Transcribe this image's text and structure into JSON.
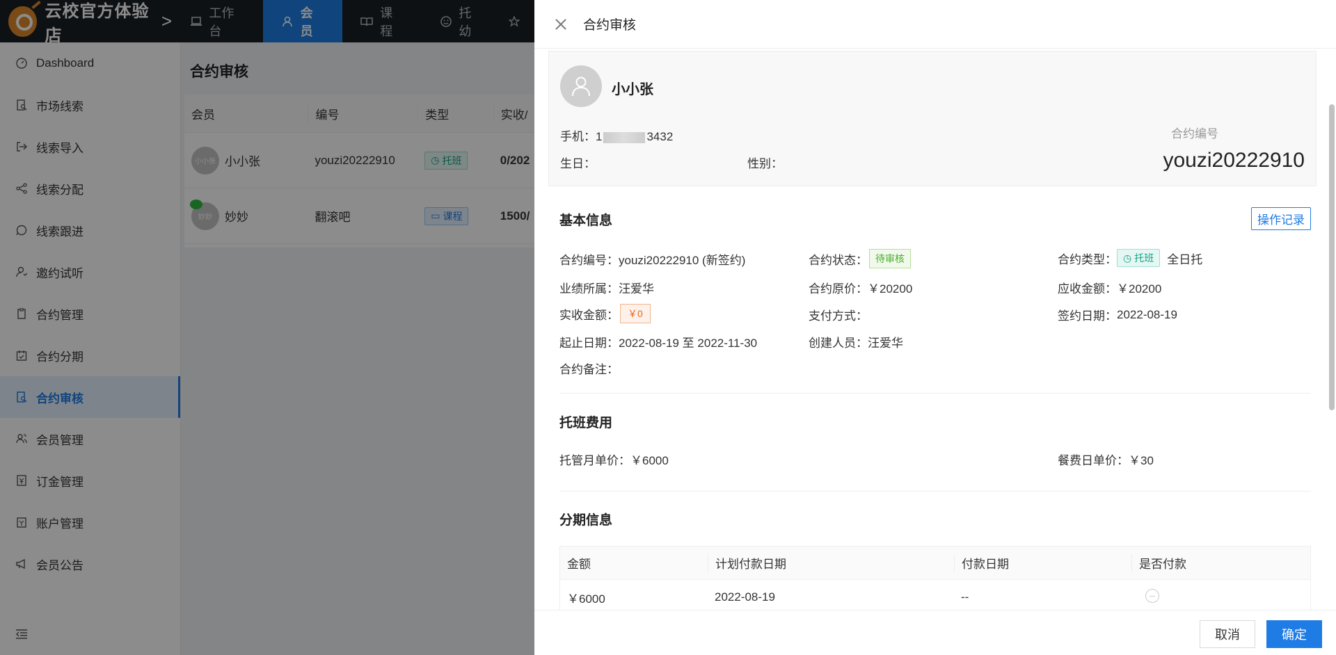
{
  "app": {
    "brand": "云校官方体验店",
    "brand_arrow": ">"
  },
  "topnav": [
    {
      "label": "工作台",
      "icon": "laptop-icon",
      "active": false
    },
    {
      "label": "会员",
      "icon": "user-icon",
      "active": true
    },
    {
      "label": "课程",
      "icon": "book-icon",
      "active": false
    },
    {
      "label": "托幼",
      "icon": "smile-icon",
      "active": false
    }
  ],
  "sidebar": {
    "items": [
      {
        "label": "Dashboard",
        "icon": "dashboard-icon"
      },
      {
        "label": "市场线索",
        "icon": "search-doc-icon"
      },
      {
        "label": "线索导入",
        "icon": "import-icon"
      },
      {
        "label": "线索分配",
        "icon": "share-icon"
      },
      {
        "label": "线索跟进",
        "icon": "whatsapp-icon"
      },
      {
        "label": "邀约试听",
        "icon": "user-icon"
      },
      {
        "label": "合约管理",
        "icon": "contract-icon"
      },
      {
        "label": "合约分期",
        "icon": "calendar-icon"
      },
      {
        "label": "合约审核",
        "icon": "audit-icon",
        "active": true
      },
      {
        "label": "会员管理",
        "icon": "users-icon"
      },
      {
        "label": "订金管理",
        "icon": "deposit-icon"
      },
      {
        "label": "账户管理",
        "icon": "account-icon"
      },
      {
        "label": "会员公告",
        "icon": "megaphone-icon"
      }
    ]
  },
  "main": {
    "title": "合约审核",
    "columns": [
      "会员",
      "编号",
      "类型",
      "实收/"
    ],
    "rows": [
      {
        "avatar_text": "小小张",
        "name": "小小张",
        "code": "youzi20222910",
        "type": "托班",
        "type_icon": "clock-icon",
        "amount": "0/202",
        "wechat": false
      },
      {
        "avatar_text": "妙妙",
        "name": "妙妙",
        "code": "翻滚吧",
        "type": "课程",
        "type_icon": "book-icon",
        "amount": "1500/",
        "wechat": true
      }
    ]
  },
  "drawer": {
    "title": "合约审核",
    "profile": {
      "name": "小小张",
      "phone_label": "手机：",
      "phone_prefix": "1",
      "phone_suffix": "3432",
      "birthday_label": "生日：",
      "gender_label": "性别：",
      "contract_no_label": "合约编号",
      "contract_no": "youzi20222910"
    },
    "basic": {
      "title": "基本信息",
      "log_button": "操作记录",
      "contract_no_label": "合约编号：",
      "contract_no": "youzi20222910 (新签约)",
      "status_label": "合约状态：",
      "status": "待审核",
      "type_label": "合约类型：",
      "type_tag": "托班",
      "type_text": "全日托",
      "owner_label": "业绩所属：",
      "owner": "汪爱华",
      "orig_price_label": "合约原价：",
      "orig_price": "￥20200",
      "receivable_label": "应收金额：",
      "receivable": "￥20200",
      "received_label": "实收金额：",
      "received": "￥0",
      "pay_method_label": "支付方式：",
      "pay_method": "",
      "sign_date_label": "签约日期：",
      "sign_date": "2022-08-19",
      "period_label": "起止日期：",
      "period": "2022-08-19 至 2022-11-30",
      "creator_label": "创建人员：",
      "creator": "汪爱华",
      "remark_label": "合约备注：",
      "remark": ""
    },
    "fees": {
      "title": "托班费用",
      "monthly_label": "托管月单价：",
      "monthly": "￥6000",
      "meal_label": "餐费日单价：",
      "meal": "￥30"
    },
    "installments": {
      "title": "分期信息",
      "columns": [
        "金额",
        "计划付款日期",
        "付款日期",
        "是否付款"
      ],
      "rows": [
        {
          "amount": "￥6000",
          "plan_date": "2022-08-19",
          "pay_date": "--"
        }
      ]
    },
    "footer": {
      "cancel": "取消",
      "ok": "确定"
    }
  }
}
